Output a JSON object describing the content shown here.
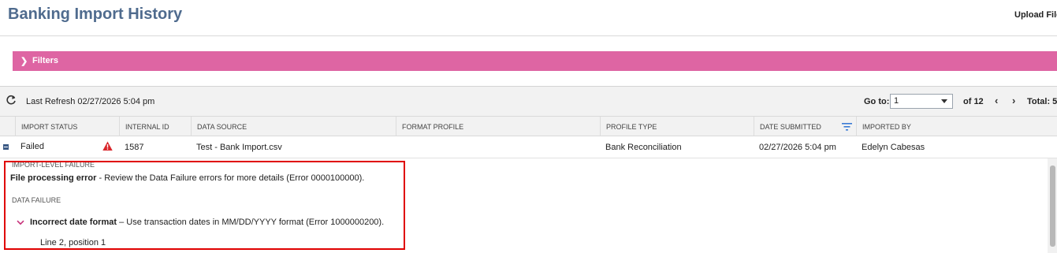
{
  "page": {
    "title": "Banking Import History",
    "upload_label": "Upload File"
  },
  "filters": {
    "label": "Filters"
  },
  "toolbar": {
    "last_refresh": "Last Refresh 02/27/2026 5:04 pm",
    "goto_label": "Go to:",
    "goto_value": "1",
    "of_pages": "of 12",
    "total": "Total: 5"
  },
  "columns": [
    "Import Status",
    "Internal ID",
    "Data Source",
    "Format Profile",
    "Profile Type",
    "Date Submitted",
    "Imported By"
  ],
  "row": {
    "status": "Failed",
    "internal_id": "1587",
    "data_source": "Test - Bank Import.csv",
    "format_profile": "",
    "profile_type": "Bank Reconciliation",
    "date_submitted": "02/27/2026 5:04 pm",
    "imported_by": "Edelyn Cabesas"
  },
  "detail": {
    "import_level_heading": "Import-Level Failure",
    "import_error_title": "File processing error",
    "import_error_text": " - Review the Data Failure errors for more details (Error 0000100000).",
    "data_failure_heading": "Data Failure",
    "data_error_title": "Incorrect date format",
    "data_error_text": " – Use transaction dates in MM/DD/YYYY format (Error 1000000200).",
    "data_error_location": "Line 2, position 1"
  },
  "colors": {
    "title": "#4f6b8e",
    "filters_bg": "#de65a3",
    "warning": "#d9262b",
    "highlight_box": "#e00000"
  },
  "icons": {
    "refresh": "refresh-icon",
    "warning": "warning-icon",
    "sort": "sort-filter-icon",
    "expand": "collapse-icon",
    "chevron": "chevron-down-icon"
  }
}
